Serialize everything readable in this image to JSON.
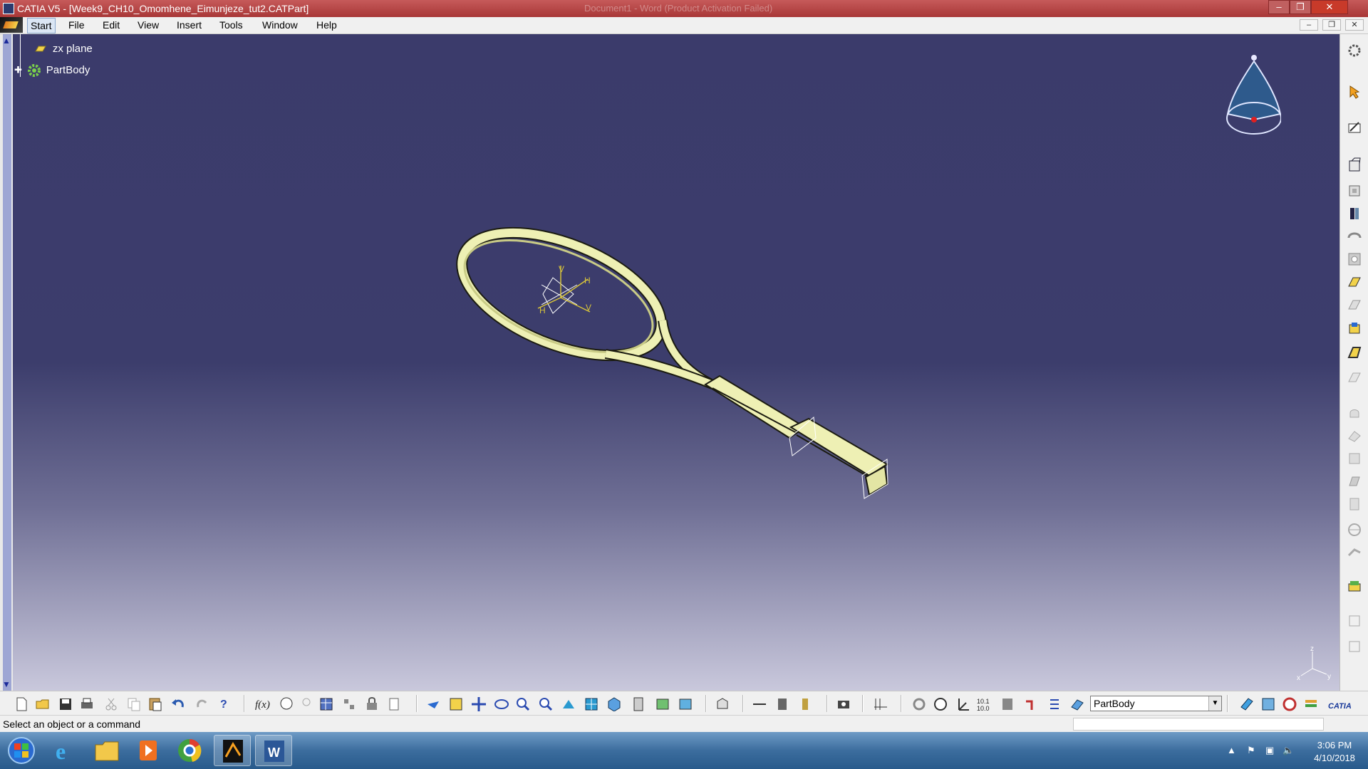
{
  "window": {
    "title": "CATIA V5 - [Week9_CH10_Omomhene_Eimunjeze_tut2.CATPart]",
    "background_title": "Document1 - Word (Product Activation Failed)",
    "controls": [
      "–",
      "❐",
      "✕"
    ],
    "mdi_controls": [
      "–",
      "❐",
      "✕"
    ]
  },
  "menu": {
    "items": [
      "Start",
      "File",
      "Edit",
      "View",
      "Insert",
      "Tools",
      "Window",
      "Help"
    ]
  },
  "tree": {
    "items": [
      {
        "label": "zx plane",
        "icon": "plane-icon"
      },
      {
        "label": "PartBody",
        "icon": "partbody-gear-icon"
      }
    ]
  },
  "model": {
    "description": "tennis racket 3D part",
    "axis_labels": {
      "v": "V",
      "h": "H"
    }
  },
  "compass": {
    "axes": [
      "z",
      "x",
      "y"
    ]
  },
  "triad": {
    "axes": [
      "z",
      "x",
      "y"
    ]
  },
  "toolbar": {
    "part_body_select": "PartBody"
  },
  "status": {
    "message": "Select an object or a command"
  },
  "taskbar": {
    "apps": [
      "windows-start",
      "internet-explorer",
      "file-explorer",
      "media-player",
      "chrome",
      "catia",
      "word"
    ],
    "time": "3:06 PM",
    "date": "4/10/2018"
  },
  "colors": {
    "title_bar": "#a83737",
    "viewport_top": "#3b3b6b",
    "viewport_bottom": "#c9c8dc",
    "model": "#f0f0b8",
    "taskbar": "#3c6d9e"
  }
}
